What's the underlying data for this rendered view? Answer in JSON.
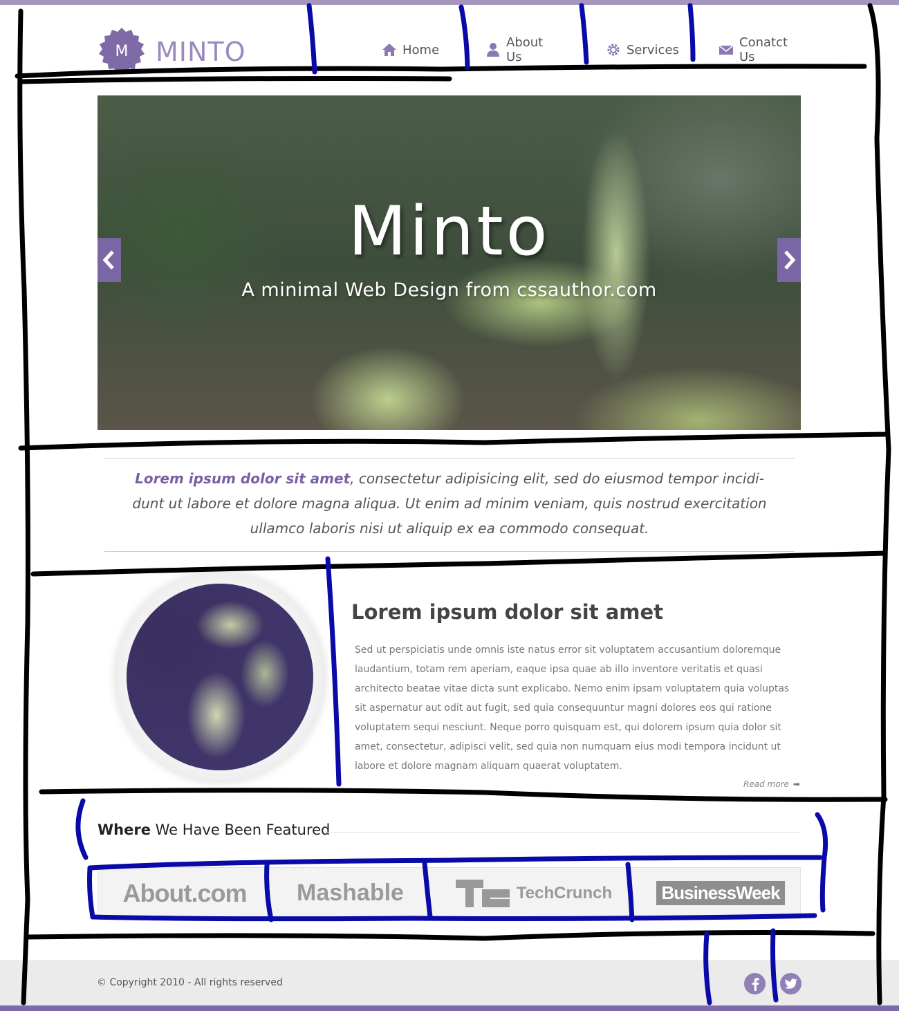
{
  "brand": {
    "logo_letter": "M",
    "name": "MINTO",
    "accent": "#7a66a4",
    "accent_light": "#9a8abf"
  },
  "nav": [
    {
      "label": "Home",
      "icon": "home-icon"
    },
    {
      "label": "About Us",
      "icon": "user-icon"
    },
    {
      "label": "Services",
      "icon": "gear-icon"
    },
    {
      "label": "Conatct Us",
      "icon": "envelope-icon"
    }
  ],
  "hero": {
    "title": "Minto",
    "subtitle": "A minimal Web Design  from cssauthor.com"
  },
  "intro": {
    "lead": "Lorem ipsum dolor sit amet",
    "rest_line1": ", consectetur adipisicing elit, sed do eiusmod tempor incidi-",
    "line2": "dunt ut labore et dolore magna aliqua. Ut enim ad minim veniam, quis nostrud exercitation",
    "line3": "ullamco laboris nisi ut aliquip ex ea commodo consequat."
  },
  "feature": {
    "title": "Lorem ipsum dolor sit amet",
    "body": "Sed ut perspiciatis unde omnis iste natus error sit voluptatem accusantium doloremque laudantium, totam rem aperiam, eaque ipsa quae ab illo inventore veritatis et quasi architecto beatae vitae dicta sunt explicabo. Nemo enim ipsam voluptatem quia voluptas sit aspernatur aut odit aut fugit, sed quia consequuntur magni dolores eos qui ratione voluptatem sequi nesciunt. Neque porro quisquam est, qui dolorem ipsum quia dolor sit amet, consectetur, adipisci velit, sed quia non numquam eius modi tempora incidunt ut labore et dolore magnam aliquam quaerat voluptatem.",
    "read_more": "Read more"
  },
  "featured": {
    "heading_bold": "Where",
    "heading_rest": " We Have Been Featured",
    "logos": [
      "About.com",
      "Mashable",
      "TechCrunch",
      "BusinessWeek"
    ]
  },
  "footer": {
    "copyright": "© Copyright 2010 - All rights reserved",
    "social": [
      "facebook-icon",
      "twitter-icon"
    ]
  }
}
